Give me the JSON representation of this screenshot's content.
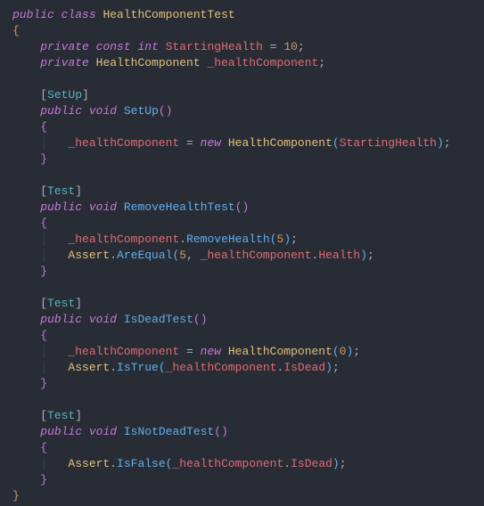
{
  "lines": [
    [
      [
        "kw",
        "public"
      ],
      [
        "pun",
        " "
      ],
      [
        "kw",
        "class"
      ],
      [
        "pun",
        " "
      ],
      [
        "classn",
        "HealthComponentTest"
      ]
    ],
    [
      [
        "brace",
        "{"
      ]
    ],
    [
      [
        "pun",
        "    "
      ],
      [
        "kw",
        "private"
      ],
      [
        "pun",
        " "
      ],
      [
        "kw",
        "const"
      ],
      [
        "pun",
        " "
      ],
      [
        "typei",
        "int"
      ],
      [
        "pun",
        " "
      ],
      [
        "name",
        "StartingHealth"
      ],
      [
        "pun",
        " = "
      ],
      [
        "num",
        "10"
      ],
      [
        "semi",
        ";"
      ]
    ],
    [
      [
        "pun",
        "    "
      ],
      [
        "kw",
        "private"
      ],
      [
        "pun",
        " "
      ],
      [
        "type",
        "HealthComponent"
      ],
      [
        "pun",
        " "
      ],
      [
        "name",
        "_healthComponent"
      ],
      [
        "semi",
        ";"
      ]
    ],
    [
      [
        "pun",
        " "
      ]
    ],
    [
      [
        "pun",
        "    ["
      ],
      [
        "attr",
        "SetUp"
      ],
      [
        "pun",
        "]"
      ]
    ],
    [
      [
        "pun",
        "    "
      ],
      [
        "kw",
        "public"
      ],
      [
        "pun",
        " "
      ],
      [
        "kw",
        "void"
      ],
      [
        "pun",
        " "
      ],
      [
        "fn",
        "SetUp"
      ],
      [
        "brace2",
        "("
      ],
      [
        "brace2",
        ")"
      ]
    ],
    [
      [
        "pun",
        "    "
      ],
      [
        "brace2",
        "{"
      ]
    ],
    [
      [
        "guide",
        "    │   "
      ],
      [
        "name",
        "_healthComponent"
      ],
      [
        "pun",
        " = "
      ],
      [
        "kw",
        "new"
      ],
      [
        "pun",
        " "
      ],
      [
        "type",
        "HealthComponent"
      ],
      [
        "brace3",
        "("
      ],
      [
        "name",
        "StartingHealth"
      ],
      [
        "brace3",
        ")"
      ],
      [
        "semi",
        ";"
      ]
    ],
    [
      [
        "pun",
        "    "
      ],
      [
        "brace2",
        "}"
      ]
    ],
    [
      [
        "pun",
        " "
      ]
    ],
    [
      [
        "pun",
        "    ["
      ],
      [
        "attr",
        "Test"
      ],
      [
        "pun",
        "]"
      ]
    ],
    [
      [
        "pun",
        "    "
      ],
      [
        "kw",
        "public"
      ],
      [
        "pun",
        " "
      ],
      [
        "kw",
        "void"
      ],
      [
        "pun",
        " "
      ],
      [
        "fn",
        "RemoveHealthTest"
      ],
      [
        "brace2",
        "("
      ],
      [
        "brace2",
        ")"
      ]
    ],
    [
      [
        "pun",
        "    "
      ],
      [
        "brace2",
        "{"
      ]
    ],
    [
      [
        "guide",
        "    │   "
      ],
      [
        "name",
        "_healthComponent"
      ],
      [
        "pun",
        "."
      ],
      [
        "fn",
        "RemoveHealth"
      ],
      [
        "brace3",
        "("
      ],
      [
        "num",
        "5"
      ],
      [
        "brace3",
        ")"
      ],
      [
        "semi",
        ";"
      ]
    ],
    [
      [
        "guide",
        "    │   "
      ],
      [
        "type",
        "Assert"
      ],
      [
        "pun",
        "."
      ],
      [
        "fn",
        "AreEqual"
      ],
      [
        "brace3",
        "("
      ],
      [
        "num",
        "5"
      ],
      [
        "pun",
        ", "
      ],
      [
        "name",
        "_healthComponent"
      ],
      [
        "pun",
        "."
      ],
      [
        "name",
        "Health"
      ],
      [
        "brace3",
        ")"
      ],
      [
        "semi",
        ";"
      ]
    ],
    [
      [
        "pun",
        "    "
      ],
      [
        "brace2",
        "}"
      ]
    ],
    [
      [
        "pun",
        " "
      ]
    ],
    [
      [
        "pun",
        "    ["
      ],
      [
        "attr",
        "Test"
      ],
      [
        "pun",
        "]"
      ]
    ],
    [
      [
        "pun",
        "    "
      ],
      [
        "kw",
        "public"
      ],
      [
        "pun",
        " "
      ],
      [
        "kw",
        "void"
      ],
      [
        "pun",
        " "
      ],
      [
        "fn",
        "IsDeadTest"
      ],
      [
        "brace2",
        "("
      ],
      [
        "brace2",
        ")"
      ]
    ],
    [
      [
        "pun",
        "    "
      ],
      [
        "brace2",
        "{"
      ]
    ],
    [
      [
        "guide",
        "    │   "
      ],
      [
        "name",
        "_healthComponent"
      ],
      [
        "pun",
        " = "
      ],
      [
        "kw",
        "new"
      ],
      [
        "pun",
        " "
      ],
      [
        "type",
        "HealthComponent"
      ],
      [
        "brace3",
        "("
      ],
      [
        "num",
        "0"
      ],
      [
        "brace3",
        ")"
      ],
      [
        "semi",
        ";"
      ]
    ],
    [
      [
        "guide",
        "    │   "
      ],
      [
        "type",
        "Assert"
      ],
      [
        "pun",
        "."
      ],
      [
        "fn",
        "IsTrue"
      ],
      [
        "brace3",
        "("
      ],
      [
        "name",
        "_healthComponent"
      ],
      [
        "pun",
        "."
      ],
      [
        "name",
        "IsDead"
      ],
      [
        "brace3",
        ")"
      ],
      [
        "semi",
        ";"
      ]
    ],
    [
      [
        "pun",
        "    "
      ],
      [
        "brace2",
        "}"
      ]
    ],
    [
      [
        "pun",
        " "
      ]
    ],
    [
      [
        "pun",
        "    ["
      ],
      [
        "attr",
        "Test"
      ],
      [
        "pun",
        "]"
      ]
    ],
    [
      [
        "pun",
        "    "
      ],
      [
        "kw",
        "public"
      ],
      [
        "pun",
        " "
      ],
      [
        "kw",
        "void"
      ],
      [
        "pun",
        " "
      ],
      [
        "fn",
        "IsNotDeadTest"
      ],
      [
        "brace2",
        "("
      ],
      [
        "brace2",
        ")"
      ]
    ],
    [
      [
        "pun",
        "    "
      ],
      [
        "brace2",
        "{"
      ]
    ],
    [
      [
        "guide",
        "    │   "
      ],
      [
        "type",
        "Assert"
      ],
      [
        "pun",
        "."
      ],
      [
        "fn",
        "IsFalse"
      ],
      [
        "brace3",
        "("
      ],
      [
        "name",
        "_healthComponent"
      ],
      [
        "pun",
        "."
      ],
      [
        "name",
        "IsDead"
      ],
      [
        "brace3",
        ")"
      ],
      [
        "semi",
        ";"
      ]
    ],
    [
      [
        "pun",
        "    "
      ],
      [
        "brace2",
        "}"
      ]
    ],
    [
      [
        "brace",
        "}"
      ],
      [
        "pun",
        "  "
      ]
    ]
  ]
}
